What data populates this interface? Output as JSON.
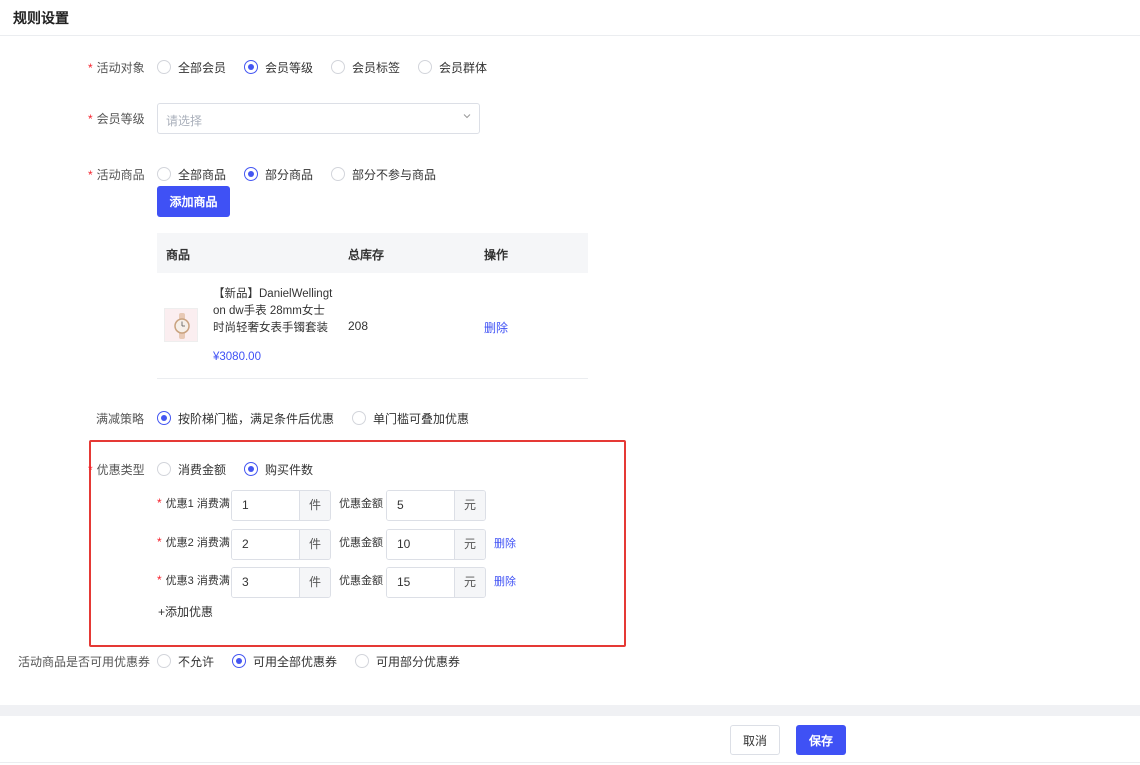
{
  "page": {
    "title": "规则设置"
  },
  "activity_target": {
    "label": "活动对象",
    "options": [
      "全部会员",
      "会员等级",
      "会员标签",
      "会员群体"
    ],
    "selected": 1
  },
  "member_level": {
    "label": "会员等级",
    "placeholder": "请选择"
  },
  "activity_goods": {
    "label": "活动商品",
    "options": [
      "全部商品",
      "部分商品",
      "部分不参与商品"
    ],
    "selected": 1,
    "add_button": "添加商品",
    "table": {
      "headers": [
        "商品",
        "总库存",
        "操作"
      ],
      "rows": [
        {
          "name": "【新品】DanielWellington dw手表 28mm女士时尚轻奢女表手镯套装",
          "price": "¥3080.00",
          "stock": "208",
          "action": "删除"
        }
      ]
    }
  },
  "discount_strategy": {
    "label": "满减策略",
    "options": [
      "按阶梯门槛，满足条件后优惠",
      "单门槛可叠加优惠"
    ],
    "selected": 0
  },
  "discount_type": {
    "label": "优惠类型",
    "options": [
      "消费金额",
      "购买件数"
    ],
    "selected": 1,
    "amount_label": "优惠金额",
    "tiers": [
      {
        "label": "优惠1 消费满",
        "qty": "1",
        "qty_unit": "件",
        "amount": "5",
        "amount_unit": "元",
        "action": ""
      },
      {
        "label": "优惠2 消费满",
        "qty": "2",
        "qty_unit": "件",
        "amount": "10",
        "amount_unit": "元",
        "action": "删除"
      },
      {
        "label": "优惠3 消费满",
        "qty": "3",
        "qty_unit": "件",
        "amount": "15",
        "amount_unit": "元",
        "action": "删除"
      }
    ],
    "add_tier": "+添加优惠"
  },
  "coupon_usage": {
    "label": "活动商品是否可用优惠券",
    "options": [
      "不允许",
      "可用全部优惠券",
      "可用部分优惠券"
    ],
    "selected": 1
  },
  "footer": {
    "cancel": "取消",
    "save": "保存"
  },
  "colors": {
    "primary": "#3f51f5",
    "highlight_box": "#e53935",
    "required": "#f5222d"
  }
}
